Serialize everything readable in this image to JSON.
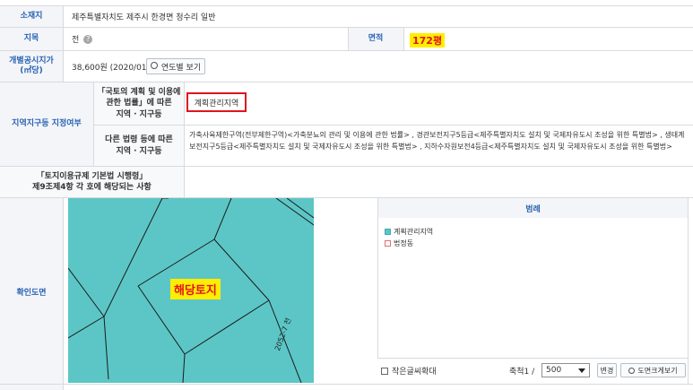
{
  "rows": {
    "location": {
      "label": "소재지",
      "value": "제주특별자치도 제주시 한경면 청수리 일반"
    },
    "landcat": {
      "label": "지목",
      "value": "전"
    },
    "area": {
      "label": "면적",
      "value": "172평"
    },
    "price": {
      "label": "개별공시지가\n(㎡당)",
      "value": "38,600원 (2020/01)",
      "button": "연도별 보기"
    },
    "zone": {
      "label": "지역지구등 지정여부",
      "sub1_label": "「국토의 계획 및 이용에\n관한 법률」에 따른\n지역 · 지구등",
      "sub1_value": "계획관리지역",
      "sub2_label": "다른 법령 등에 따른\n지역 · 지구등",
      "sub2_value": "가축사육제한구역(전부제한구역)<가축분뇨의 관리 및 이용에 관한 법률> , 경관보전지구5등급<제주특별자치도 설치 및 국제자유도시 조성을 위한 특별법> , 생태계보전지구5등급<제주특별자치도 설치 및 국제자유도시 조성을 위한 특별법> , 지하수자원보전4등급<제주특별자치도 설치 및 국제자유도시 조성을 위한 특별법>"
    },
    "enforcement": {
      "label": "「토지이용규제 기본법 시행령」\n제9조제4항 각 호에 해당되는 사항",
      "value": ""
    },
    "map": {
      "label": "확인도면",
      "overlay": "해당토지",
      "road_label": "2052-7 전",
      "legend_title": "범례",
      "legend_items": [
        {
          "label": "계획관리지역",
          "color": "#5cc6c6"
        },
        {
          "label": "법정동",
          "color": "#f4c6c6"
        }
      ],
      "small_font_label": "작은글씨확대",
      "scale_label": "축척1 /",
      "scale_value": "500",
      "change_button": "변경",
      "map_view_button": "도면크게보기"
    }
  },
  "colors": {
    "accent_label": "#2a63b4",
    "map_fill": "#5cc6c6",
    "highlight": "#ffee00",
    "annotation_red": "#e0141c"
  }
}
